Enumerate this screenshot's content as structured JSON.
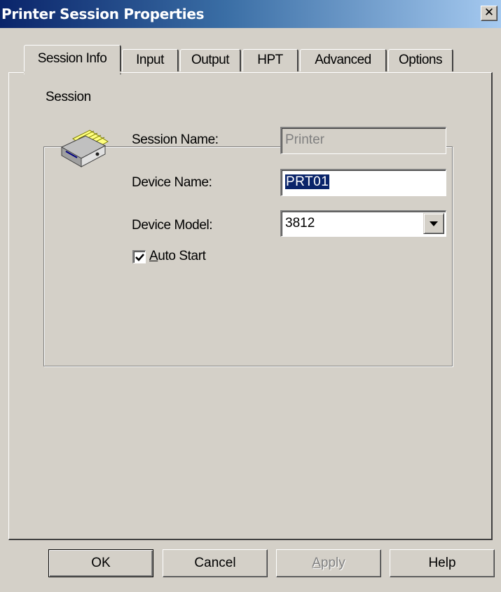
{
  "window": {
    "title": "Printer Session Properties",
    "close_glyph": "✕"
  },
  "tabs": [
    {
      "label": "Session Info",
      "active": true
    },
    {
      "label": "Input",
      "active": false
    },
    {
      "label": "Output",
      "active": false
    },
    {
      "label": "HPT",
      "active": false
    },
    {
      "label": "Advanced",
      "active": false
    },
    {
      "label": "Options",
      "active": false
    }
  ],
  "session_group": {
    "title": "Session",
    "icon": "printer-icon",
    "session_name_label": "Session Name:",
    "session_name_value": "Printer",
    "device_name_label": "Device Name:",
    "device_name_value": "PRT01",
    "device_model_label": "Device Model:",
    "device_model_value": "3812",
    "auto_start_first": "A",
    "auto_start_rest": "uto Start",
    "auto_start_checked": true
  },
  "buttons": {
    "ok": "OK",
    "cancel": "Cancel",
    "apply_first": "A",
    "apply_rest": "pply",
    "help": "Help"
  }
}
